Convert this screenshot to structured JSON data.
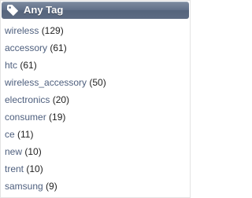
{
  "header": {
    "title": "Any Tag",
    "icon": "tag-icon"
  },
  "tags": [
    {
      "label": "wireless",
      "count": "(129)"
    },
    {
      "label": "accessory",
      "count": "(61)"
    },
    {
      "label": "htc",
      "count": "(61)"
    },
    {
      "label": "wireless_accessory",
      "count": "(50)"
    },
    {
      "label": "electronics",
      "count": "(20)"
    },
    {
      "label": "consumer",
      "count": "(19)"
    },
    {
      "label": "ce",
      "count": "(11)"
    },
    {
      "label": "new",
      "count": "(10)"
    },
    {
      "label": "trent",
      "count": "(10)"
    },
    {
      "label": "samsung",
      "count": "(9)"
    }
  ],
  "colors": {
    "header_bg": "#627189",
    "link": "#4e5f7e",
    "count": "#1f1f1f"
  }
}
